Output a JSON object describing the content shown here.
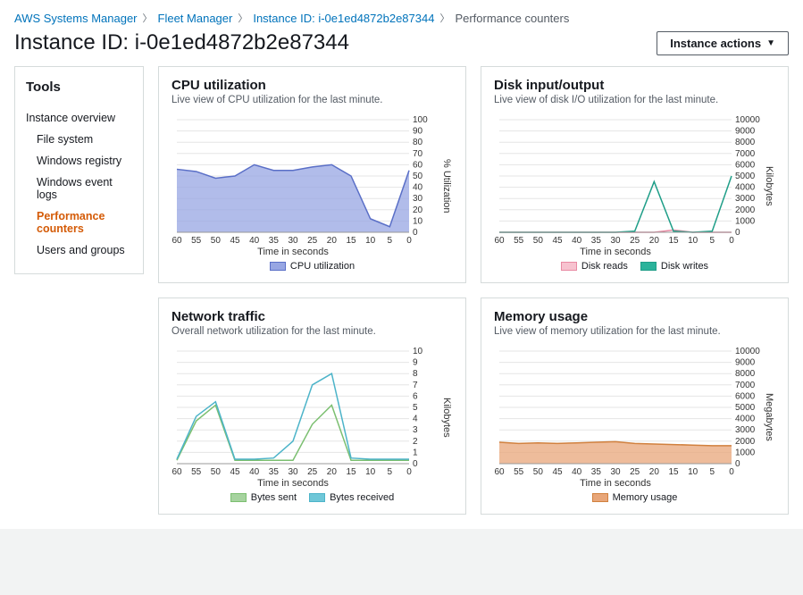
{
  "breadcrumbs": {
    "items": [
      {
        "label": "AWS Systems Manager",
        "link": true
      },
      {
        "label": "Fleet Manager",
        "link": true
      },
      {
        "label": "Instance ID: i-0e1ed4872b2e87344",
        "link": true
      },
      {
        "label": "Performance counters",
        "link": false
      }
    ]
  },
  "header": {
    "title": "Instance ID: i-0e1ed4872b2e87344",
    "actions_label": "Instance actions"
  },
  "sidebar": {
    "title": "Tools",
    "items": [
      {
        "label": "Instance overview",
        "sub": false,
        "active": false
      },
      {
        "label": "File system",
        "sub": true,
        "active": false
      },
      {
        "label": "Windows registry",
        "sub": true,
        "active": false
      },
      {
        "label": "Windows event logs",
        "sub": true,
        "active": false
      },
      {
        "label": "Performance counters",
        "sub": true,
        "active": true
      },
      {
        "label": "Users and groups",
        "sub": true,
        "active": false
      }
    ]
  },
  "chart_data": [
    {
      "id": "cpu",
      "title": "CPU utilization",
      "subtitle": "Live view of CPU utilization for the last minute.",
      "type": "area",
      "xlabel": "Time in seconds",
      "ylabel": "% Utilization",
      "x": [
        60,
        55,
        50,
        45,
        40,
        35,
        30,
        25,
        20,
        15,
        10,
        5,
        0
      ],
      "ylim": [
        0,
        100
      ],
      "yticks": [
        0,
        10,
        20,
        30,
        40,
        50,
        60,
        70,
        80,
        90,
        100
      ],
      "series": [
        {
          "name": "CPU utilization",
          "color": "#97a6e3",
          "stroke": "#5a6fc7",
          "fill": true,
          "values": [
            56,
            54,
            48,
            50,
            60,
            55,
            55,
            58,
            60,
            50,
            12,
            5,
            55
          ]
        }
      ]
    },
    {
      "id": "disk",
      "title": "Disk input/output",
      "subtitle": "Live view of disk I/O utilization for the last minute.",
      "type": "line",
      "xlabel": "Time in seconds",
      "ylabel": "Kilobytes",
      "x": [
        60,
        55,
        50,
        45,
        40,
        35,
        30,
        25,
        20,
        15,
        10,
        5,
        0
      ],
      "ylim": [
        0,
        10000
      ],
      "yticks": [
        0,
        1000,
        2000,
        3000,
        4000,
        5000,
        6000,
        7000,
        8000,
        9000,
        10000
      ],
      "series": [
        {
          "name": "Disk reads",
          "color": "#f7c2cf",
          "stroke": "#e88aa3",
          "fill": false,
          "values": [
            0,
            0,
            0,
            0,
            0,
            0,
            0,
            0,
            0,
            200,
            0,
            0,
            0
          ]
        },
        {
          "name": "Disk writes",
          "color": "#2bb39b",
          "stroke": "#1f9e88",
          "fill": false,
          "values": [
            0,
            0,
            0,
            0,
            0,
            0,
            0,
            100,
            4500,
            100,
            0,
            100,
            5000
          ]
        }
      ]
    },
    {
      "id": "network",
      "title": "Network traffic",
      "subtitle": "Overall network utilization for the last minute.",
      "type": "line",
      "xlabel": "Time in seconds",
      "ylabel": "Kilobytes",
      "x": [
        60,
        55,
        50,
        45,
        40,
        35,
        30,
        25,
        20,
        15,
        10,
        5,
        0
      ],
      "ylim": [
        0,
        10
      ],
      "yticks": [
        0,
        1,
        2,
        3,
        4,
        5,
        6,
        7,
        8,
        9,
        10
      ],
      "series": [
        {
          "name": "Bytes sent",
          "color": "#a6d39f",
          "stroke": "#7bbf70",
          "fill": false,
          "values": [
            0.3,
            3.8,
            5.2,
            0.3,
            0.3,
            0.3,
            0.3,
            3.5,
            5.2,
            0.3,
            0.3,
            0.3,
            0.3
          ]
        },
        {
          "name": "Bytes received",
          "color": "#6fc7d8",
          "stroke": "#4db4c9",
          "fill": false,
          "values": [
            0.4,
            4.2,
            5.5,
            0.4,
            0.4,
            0.5,
            2.0,
            7.0,
            8.0,
            0.5,
            0.4,
            0.4,
            0.4
          ]
        }
      ]
    },
    {
      "id": "memory",
      "title": "Memory usage",
      "subtitle": "Live view of memory utilization for the last minute.",
      "type": "area",
      "xlabel": "Time in seconds",
      "ylabel": "Megabytes",
      "x": [
        60,
        55,
        50,
        45,
        40,
        35,
        30,
        25,
        20,
        15,
        10,
        5,
        0
      ],
      "ylim": [
        0,
        10000
      ],
      "yticks": [
        0,
        1000,
        2000,
        3000,
        4000,
        5000,
        6000,
        7000,
        8000,
        9000,
        10000
      ],
      "series": [
        {
          "name": "Memory usage",
          "color": "#e8a679",
          "stroke": "#d1813f",
          "fill": true,
          "values": [
            1900,
            1800,
            1850,
            1800,
            1850,
            1900,
            1950,
            1800,
            1750,
            1700,
            1650,
            1600,
            1600
          ]
        }
      ]
    }
  ]
}
